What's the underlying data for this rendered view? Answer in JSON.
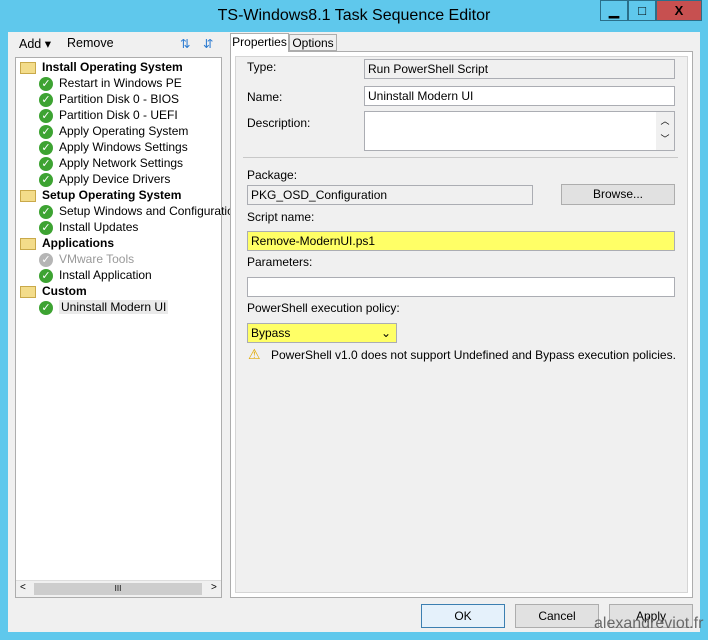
{
  "window": {
    "title": "TS-Windows8.1 Task Sequence Editor",
    "minimize": "▁",
    "maximize": "□",
    "close": "X"
  },
  "toolbar": {
    "add": "Add",
    "remove": "Remove"
  },
  "tree": [
    {
      "label": "Install Operating System",
      "group": true
    },
    {
      "label": "Restart in Windows PE"
    },
    {
      "label": "Partition Disk 0 - BIOS"
    },
    {
      "label": "Partition Disk 0 - UEFI"
    },
    {
      "label": "Apply Operating System"
    },
    {
      "label": "Apply Windows Settings"
    },
    {
      "label": "Apply Network Settings"
    },
    {
      "label": "Apply Device Drivers"
    },
    {
      "label": "Setup Operating System",
      "group": true
    },
    {
      "label": "Setup Windows and Configuration"
    },
    {
      "label": "Install Updates"
    },
    {
      "label": "Applications",
      "group": true
    },
    {
      "label": "VMware Tools",
      "disabled": true
    },
    {
      "label": "Install Application"
    },
    {
      "label": "Custom",
      "group": true
    },
    {
      "label": "Uninstall Modern UI",
      "selected": true
    }
  ],
  "tabs": {
    "properties": "Properties",
    "options": "Options"
  },
  "props": {
    "type_label": "Type:",
    "type_value": "Run PowerShell Script",
    "name_label": "Name:",
    "name_value": "Uninstall Modern UI",
    "description_label": "Description:",
    "description_value": "",
    "package_label": "Package:",
    "package_value": "PKG_OSD_Configuration",
    "browse": "Browse...",
    "script_label": "Script name:",
    "script_value": "Remove-ModernUI.ps1",
    "params_label": "Parameters:",
    "params_value": "",
    "policy_label": "PowerShell execution policy:",
    "policy_value": "Bypass",
    "warning": "PowerShell v1.0 does not support Undefined and Bypass execution policies."
  },
  "buttons": {
    "ok": "OK",
    "cancel": "Cancel",
    "apply": "Apply"
  },
  "watermark": "alexandreviot.fr"
}
